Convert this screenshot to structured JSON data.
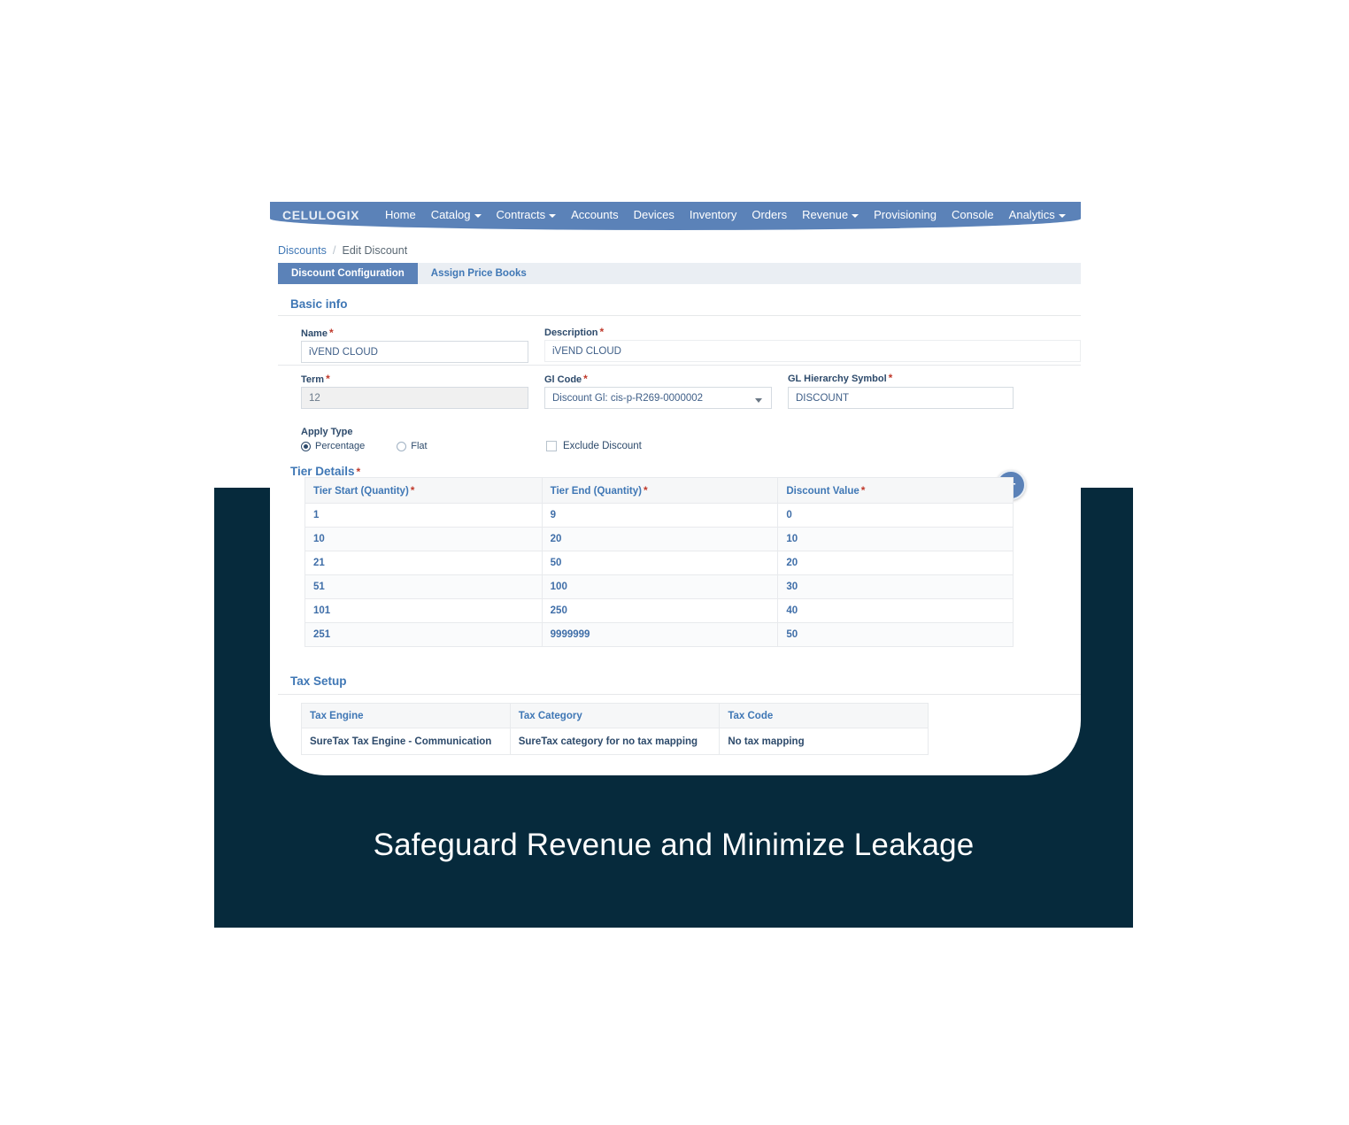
{
  "promo": {
    "headline": "Safeguard Revenue and Minimize Leakage",
    "bg_color": "#062a3c"
  },
  "nav": {
    "logo": "CELULOGIX",
    "brand_color": "#5b82b8",
    "items": [
      {
        "label": "Home",
        "has_caret": false
      },
      {
        "label": "Catalog",
        "has_caret": true
      },
      {
        "label": "Contracts",
        "has_caret": true
      },
      {
        "label": "Accounts",
        "has_caret": false
      },
      {
        "label": "Devices",
        "has_caret": false
      },
      {
        "label": "Inventory",
        "has_caret": false
      },
      {
        "label": "Orders",
        "has_caret": false
      },
      {
        "label": "Revenue",
        "has_caret": true
      },
      {
        "label": "Provisioning",
        "has_caret": false
      },
      {
        "label": "Console",
        "has_caret": false
      },
      {
        "label": "Analytics",
        "has_caret": true
      }
    ]
  },
  "breadcrumb": {
    "root": "Discounts",
    "separator": "/",
    "current": "Edit Discount"
  },
  "tabs": [
    {
      "label": "Discount Configuration",
      "active": true
    },
    {
      "label": "Assign Price Books",
      "active": false
    }
  ],
  "basic_info": {
    "title": "Basic info",
    "fields": {
      "name": {
        "label": "Name",
        "required": "*",
        "value": "iVEND CLOUD"
      },
      "description": {
        "label": "Description",
        "required": "*",
        "value": "iVEND CLOUD"
      },
      "term": {
        "label": "Term",
        "required": "*",
        "value": "12",
        "disabled": true
      },
      "gl_code": {
        "label": "Gl Code",
        "required": "*",
        "value": "Discount Gl: cis-p-R269-0000002",
        "type": "select"
      },
      "gl_hierarchy_symbol": {
        "label": "GL Hierarchy Symbol",
        "required": "*",
        "value": "DISCOUNT"
      }
    }
  },
  "apply_type": {
    "label": "Apply Type",
    "options": [
      {
        "label": "Percentage",
        "selected": true
      },
      {
        "label": "Flat",
        "selected": false
      }
    ],
    "exclude_discount": {
      "label": "Exclude Discount",
      "checked": false
    }
  },
  "tier_details": {
    "title": "Tier Details",
    "required": "*",
    "add_button": "+",
    "columns": [
      {
        "label": "Tier Start (Quantity)",
        "required": "*"
      },
      {
        "label": "Tier End (Quantity)",
        "required": "*"
      },
      {
        "label": "Discount Value",
        "required": "*"
      }
    ],
    "rows": [
      {
        "start": "1",
        "end": "9",
        "value": "0"
      },
      {
        "start": "10",
        "end": "20",
        "value": "10"
      },
      {
        "start": "21",
        "end": "50",
        "value": "20"
      },
      {
        "start": "51",
        "end": "100",
        "value": "30"
      },
      {
        "start": "101",
        "end": "250",
        "value": "40"
      },
      {
        "start": "251",
        "end": "9999999",
        "value": "50"
      }
    ]
  },
  "tax_setup": {
    "title": "Tax Setup",
    "columns": [
      "Tax Engine",
      "Tax Category",
      "Tax Code"
    ],
    "rows": [
      {
        "engine": "SureTax Tax Engine - Communication",
        "category": "SureTax category for no tax mapping",
        "code": "No tax mapping"
      }
    ]
  }
}
